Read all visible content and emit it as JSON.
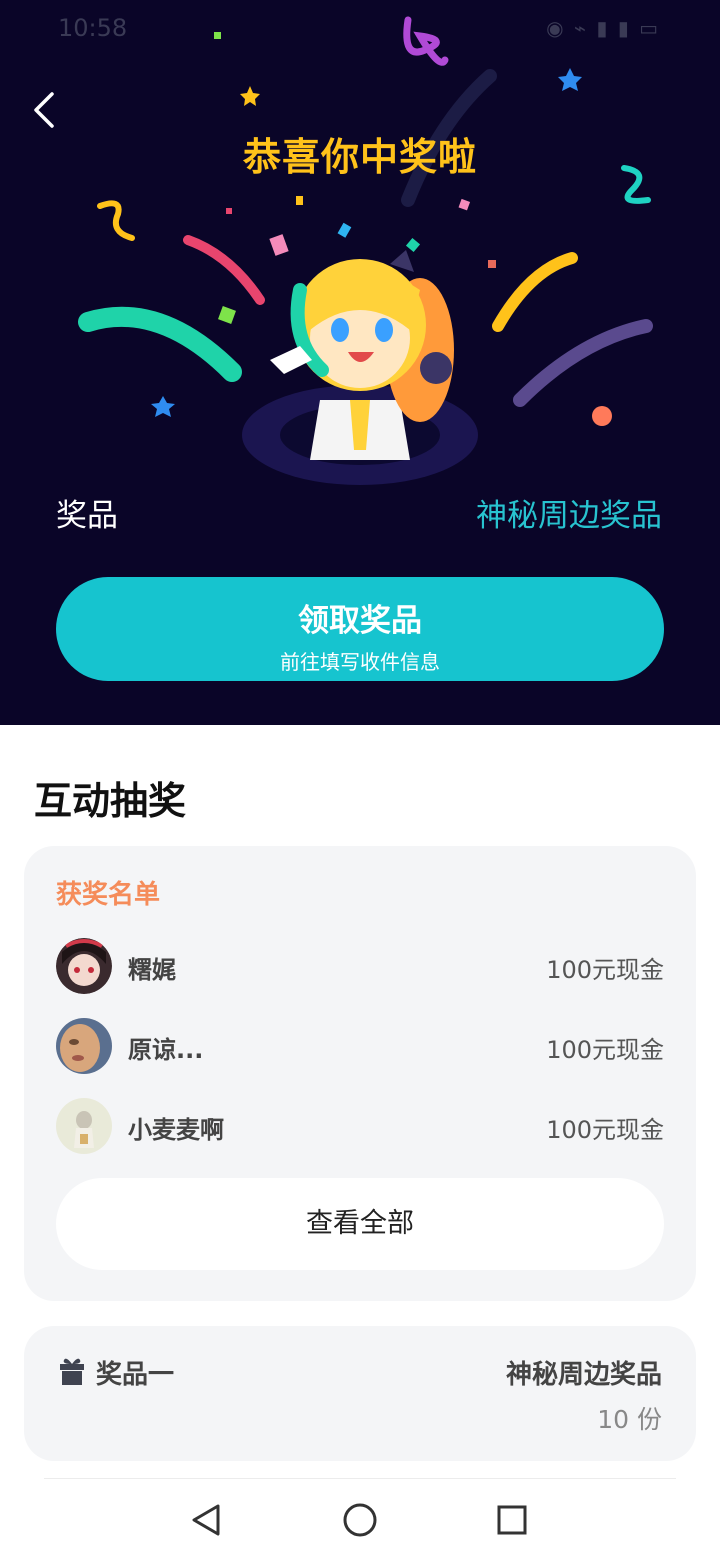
{
  "status_bar": {
    "time": "10:58",
    "icons_text": "◉ ⌁ ▮ ▮ ▭"
  },
  "hero": {
    "title": "恭喜你中奖啦",
    "prize_label": "奖品",
    "prize_value": "神秘周边奖品"
  },
  "claim": {
    "main": "领取奖品",
    "sub": "前往填写收件信息"
  },
  "section": {
    "title": "互动抽奖"
  },
  "winners": {
    "title": "获奖名单",
    "list": [
      {
        "name": "糬娓",
        "prize": "100元现金"
      },
      {
        "name": "原谅...",
        "prize": "100元现金"
      },
      {
        "name": "小麦麦啊",
        "prize": "100元现金"
      }
    ],
    "view_all": "查看全部"
  },
  "prize_card": {
    "label": "奖品一",
    "name": "神秘周边奖品",
    "quantity": "10 份"
  },
  "colors": {
    "hero_bg": "#0a0528",
    "accent": "#16c4cf",
    "title_yellow": "#ffc21a",
    "winners_orange": "#f58c5a"
  },
  "icons": [
    "back-arrow-icon",
    "gift-icon",
    "nav-back-icon",
    "nav-home-icon",
    "nav-recents-icon"
  ]
}
